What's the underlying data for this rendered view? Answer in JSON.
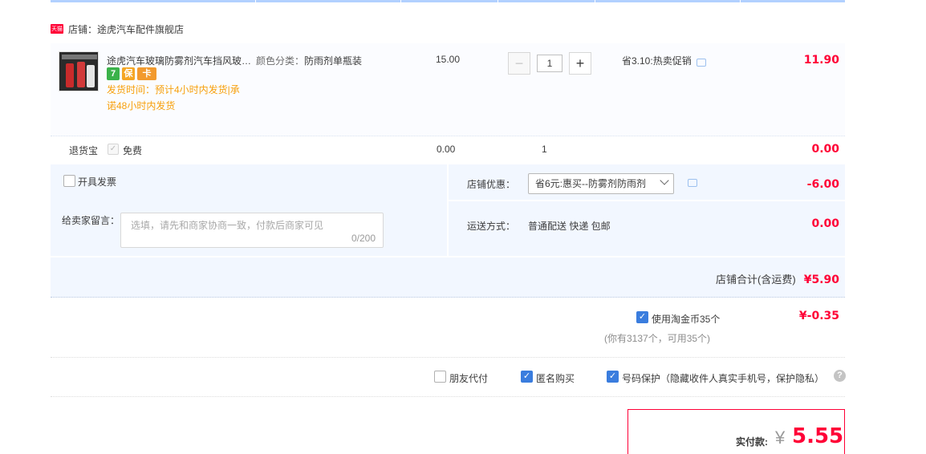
{
  "shop": {
    "badge": "天猫",
    "label": "店铺：途虎汽车配件旗舰店"
  },
  "item": {
    "title": "途虎汽车玻璃防雾剂汽车挡风玻…",
    "service_icons": [
      "7",
      "保",
      "卡"
    ],
    "ship_time": "发货时间：预计4小时内发货|承诺48小时内发货",
    "spec_label": "颜色分类：",
    "spec_value": "防雨剂单瓶装",
    "unit_price": "15.00",
    "qty_minus": "−",
    "quantity": "1",
    "qty_plus": "+",
    "promo": "省3.10:热卖促销",
    "total": "11.90"
  },
  "return_insurance": {
    "label": "退货宝",
    "check": "✓",
    "free_label": "免费",
    "price": "0.00",
    "qty": "1",
    "total": "0.00"
  },
  "options": {
    "invoice_label": "开具发票",
    "message_label": "给卖家留言：",
    "message_placeholder": "选填，请先和商家协商一致，付款后商家可见",
    "message_count": "0/200",
    "coupon_label": "店铺优惠：",
    "coupon_value": "省6元:惠买--防雾剂防雨剂",
    "coupon_amount": "-6.00",
    "shipping_label": "运送方式：",
    "shipping_value": "普通配送 快递 包邮",
    "shipping_amount": "0.00",
    "shop_total_label": "店铺合计(含运费)",
    "shop_total_value": "¥5.90"
  },
  "coins": {
    "check": "✓",
    "label": "使用淘金币35个",
    "sub": "(你有3137个，可用35个)",
    "amount": "¥-0.35"
  },
  "privacy": {
    "friend_pay": "朋友代付",
    "anonymous_check": "✓",
    "anonymous": "匿名购买",
    "number_protect_check": "✓",
    "number_protect": "号码保护（隐藏收件人真实手机号，保护隐私）",
    "help": "?"
  },
  "payment": {
    "label": "实付款:",
    "currency": "¥",
    "amount": "5.55"
  },
  "colors": {
    "accent_red": "#ff0036",
    "checkbox_blue": "#3a7dde",
    "panel_blue": "#f2f7ff",
    "ship_time_orange": "#f7a00c"
  }
}
